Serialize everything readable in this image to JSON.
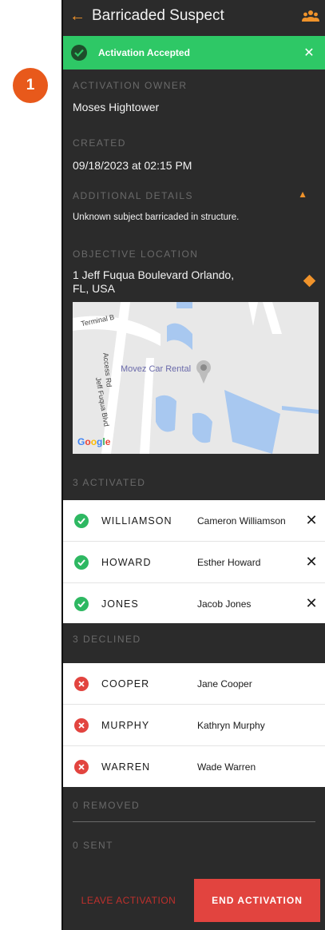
{
  "step_badge": "1",
  "header": {
    "title": "Barricaded Suspect",
    "back_icon": "arrow-left-icon",
    "people_icon": "group-icon"
  },
  "banner": {
    "text": "Activation Accepted",
    "status_color": "#2ec866"
  },
  "owner": {
    "label": "ACTIVATION OWNER",
    "value": "Moses Hightower"
  },
  "created": {
    "label": "CREATED",
    "value": "09/18/2023 at 02:15 PM"
  },
  "details": {
    "label": "ADDITIONAL DETAILS",
    "value": "Unknown subject barricaded in structure."
  },
  "location": {
    "label": "OBJECTIVE LOCATION",
    "line1": "1 Jeff Fuqua Boulevard Orlando,",
    "line2": "FL, USA"
  },
  "map": {
    "poi": "Movez Car Rental",
    "road1": "Terminal B",
    "road2": "Access Rd",
    "road3": "Jeff Fuqua Blvd",
    "logo": "Google"
  },
  "activated": {
    "header": "3 ACTIVATED",
    "items": [
      {
        "last": "WILLIAMSON",
        "full": "Cameron Williamson"
      },
      {
        "last": "HOWARD",
        "full": "Esther Howard"
      },
      {
        "last": "JONES",
        "full": "Jacob Jones"
      }
    ]
  },
  "declined": {
    "header": "3 DECLINED",
    "items": [
      {
        "last": "COOPER",
        "full": "Jane Cooper"
      },
      {
        "last": "MURPHY",
        "full": "Kathryn Murphy"
      },
      {
        "last": "WARREN",
        "full": "Wade Warren"
      }
    ]
  },
  "removed": {
    "header": "0 REMOVED"
  },
  "sent": {
    "header": "0 SENT"
  },
  "footer": {
    "leave_label": "LEAVE ACTIVATION",
    "end_label": "END ACTIVATION"
  },
  "colors": {
    "accent": "#f0932b",
    "danger": "#e2443f",
    "success": "#2eb862",
    "background": "#2b2b2b"
  }
}
